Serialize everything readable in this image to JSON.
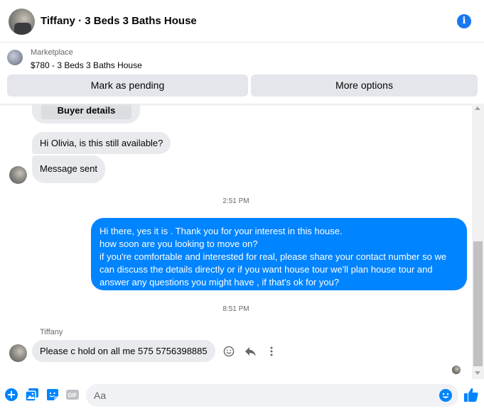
{
  "header": {
    "title": "Tiffany · 3 Beds 3 Baths House",
    "info_icon": "info-icon"
  },
  "marketplace": {
    "label": "Marketplace",
    "listing": "$780 - 3 Beds 3 Baths House",
    "mark_pending_label": "Mark as pending",
    "more_options_label": "More options"
  },
  "chat": {
    "buyer_details_label": "Buyer details",
    "messages": [
      {
        "from": "Tiffany",
        "text": "Hi Olivia, is this still available?"
      },
      {
        "from": "Tiffany",
        "text": "Message sent"
      }
    ],
    "timestamp_1": "2:51 PM",
    "outgoing_lines": [
      "Hi there, yes it is . Thank you for your interest in this house.",
      "how soon are you looking to move on?",
      "if you're comfortable and interested for real, please share your contact number so we",
      "can discuss the details directly or if you  want house tour we'll plan house tour and",
      "answer any questions you might have , if that's ok for you?"
    ],
    "timestamp_2": "8:51 PM",
    "last_sender": "Tiffany",
    "last_message": "Please c hold on all me 575 5756398885"
  },
  "composer": {
    "placeholder": "Aa",
    "icons": [
      "plus-icon",
      "photo-icon",
      "sticker-icon",
      "gif-icon",
      "emoji-icon",
      "like-icon"
    ]
  },
  "colors": {
    "accent": "#0084ff",
    "brand": "#1877f2",
    "incoming_bubble": "#e9eaed",
    "button_bg": "#e4e6eb"
  }
}
